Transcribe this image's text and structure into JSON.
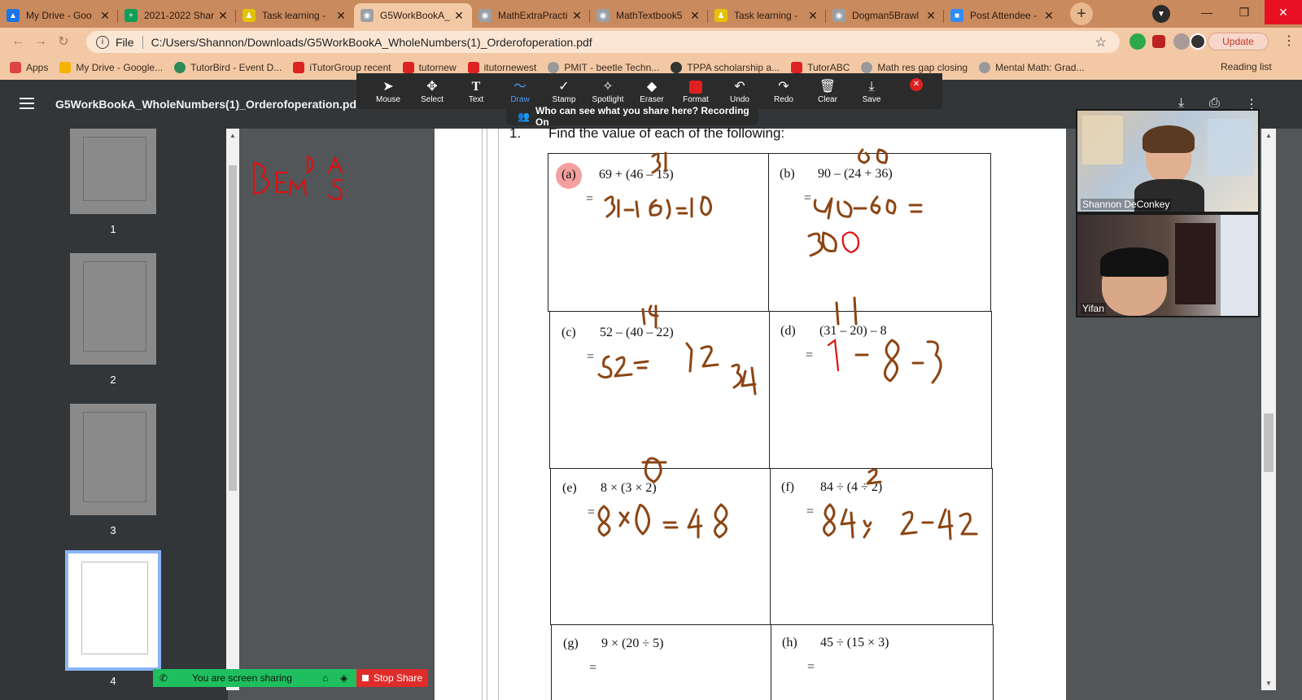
{
  "browser": {
    "tabs": [
      {
        "title": "My Drive - Goo",
        "icon_color": "#1a73e8"
      },
      {
        "title": "2021-2022 Shar",
        "icon_color": "#0f9d58"
      },
      {
        "title": "Task learning - ",
        "icon_color": "#e6c200"
      },
      {
        "title": "G5WorkBookA_",
        "icon_color": "#9aa0a6",
        "active": true
      },
      {
        "title": "MathExtraPracti",
        "icon_color": "#9aa0a6"
      },
      {
        "title": "MathTextbook5",
        "icon_color": "#9aa0a6"
      },
      {
        "title": "Task learning - ",
        "icon_color": "#e6c200"
      },
      {
        "title": "Dogman5Brawl",
        "icon_color": "#9aa0a6"
      },
      {
        "title": "Post Attendee -",
        "icon_color": "#2d8cff"
      }
    ],
    "new_tab": "+",
    "address": {
      "info": "i",
      "scheme": "File",
      "url": "C:/Users/Shannon/Downloads/G5WorkBookA_WholeNumbers(1)_Orderofoperation.pdf"
    },
    "update_button": "Update",
    "bookmarks": [
      {
        "label": "Apps",
        "color": "#d44"
      },
      {
        "label": "My Drive - Google...",
        "color": "#f4b400"
      },
      {
        "label": "TutorBird - Event D...",
        "color": "#2e8b57"
      },
      {
        "label": "iTutorGroup recent",
        "color": "#d22"
      },
      {
        "label": "tutornew",
        "color": "#d22"
      },
      {
        "label": "itutornewest",
        "color": "#d22"
      },
      {
        "label": "PMIT - beetle Techn...",
        "color": "#999"
      },
      {
        "label": "TPPA scholarship a...",
        "color": "#333"
      },
      {
        "label": "TutorABC",
        "color": "#d22"
      },
      {
        "label": "Math res gap closing",
        "color": "#999"
      },
      {
        "label": "Mental Math: Grad...",
        "color": "#999"
      }
    ],
    "reading_list": "Reading list"
  },
  "pdf": {
    "title": "G5WorkBookA_WholeNumbers(1)_Orderofoperation.pdf",
    "thumbnails": [
      "1",
      "2",
      "3",
      "4"
    ],
    "question_number": "1.",
    "question_text": "Find the value of each of the following:",
    "problems": [
      {
        "label": "(a)",
        "expr": "69 + (46 – 15)",
        "eq": "="
      },
      {
        "label": "(b)",
        "expr": "90 – (24 + 36)",
        "eq": "="
      },
      {
        "label": "(c)",
        "expr": "52 – (40 – 22)",
        "eq": "="
      },
      {
        "label": "(d)",
        "expr": "(31 – 20) – 8",
        "eq": "="
      },
      {
        "label": "(e)",
        "expr": "8 × (3 × 2)",
        "eq": "="
      },
      {
        "label": "(f)",
        "expr": "84 ÷ (4 ÷ 2)",
        "eq": "="
      },
      {
        "label": "(g)",
        "expr": "9 × (20 ÷ 5)",
        "eq": "="
      },
      {
        "label": "(h)",
        "expr": "45 ÷ (15 × 3)",
        "eq": "="
      }
    ]
  },
  "annotate_toolbar": {
    "tools": [
      "Mouse",
      "Select",
      "Text",
      "Draw",
      "Stamp",
      "Spotlight",
      "Eraser",
      "Format",
      "Undo",
      "Redo",
      "Clear",
      "Save"
    ],
    "active_tool": "Draw",
    "banner": "Who can see what you share here? Recording On"
  },
  "video": {
    "participants": [
      {
        "name": "Shannon DeConkey"
      },
      {
        "name": "Yifan"
      }
    ]
  },
  "screen_share": {
    "status": "You are screen sharing",
    "stop": "Stop Share"
  },
  "colors": {
    "ink_brown": "#8B4513",
    "ink_red": "#e01010",
    "tab_strip": "#c98a5e",
    "toolbar": "#f3c9a5"
  }
}
